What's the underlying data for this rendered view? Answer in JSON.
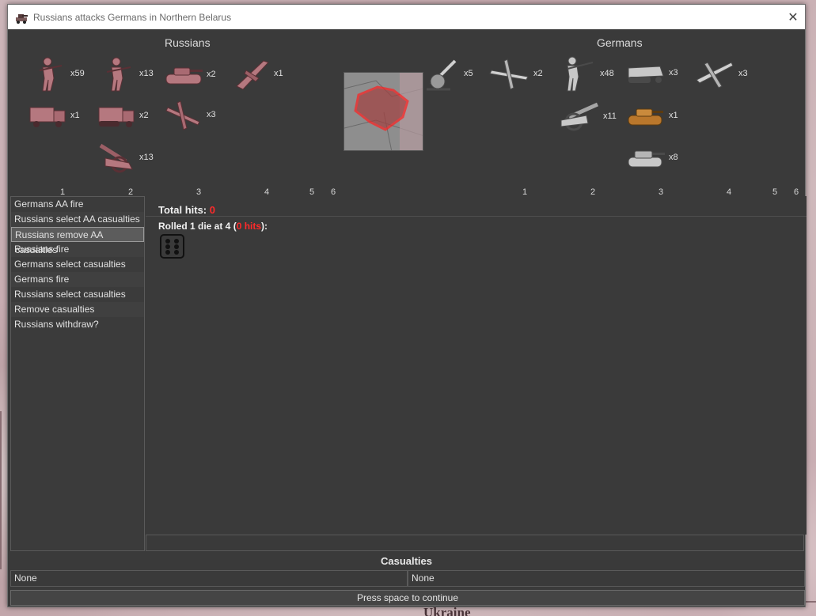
{
  "window": {
    "title": "Russians attacks Germans in Northern Belarus",
    "close_glyph": "✕"
  },
  "battle": {
    "attacker": {
      "name": "Russians",
      "color": "#b5787f",
      "units": [
        {
          "icon": "infantry-icon",
          "count": "x59"
        },
        {
          "icon": "infantry-icon",
          "count": "x13"
        },
        {
          "icon": "tank-icon",
          "count": "x2"
        },
        {
          "icon": "bomber-icon",
          "count": "x1"
        },
        {
          "icon": "truck-icon",
          "count": "x1"
        },
        {
          "icon": "halftrack-icon",
          "count": "x2"
        },
        {
          "icon": "fighter-icon",
          "count": "x3"
        },
        {
          "icon": "artillery-icon",
          "count": "x13"
        }
      ],
      "ruler": [
        "1",
        "2",
        "3",
        "4",
        "5",
        "6"
      ]
    },
    "defender": {
      "name": "Germans",
      "color": "#c8c8c8",
      "units": [
        {
          "icon": "aa-gun-icon",
          "count": "x5"
        },
        {
          "icon": "bomber-icon",
          "count": "x2"
        },
        {
          "icon": "infantry-icon",
          "count": "x48"
        },
        {
          "icon": "halftrack-icon",
          "count": "x3"
        },
        {
          "icon": "fighter-icon",
          "count": "x3"
        },
        {
          "icon": "artillery-icon",
          "count": "x11"
        },
        {
          "icon": "tank-icon",
          "count": "x1"
        },
        {
          "icon": "heavy-tank-icon",
          "count": "x8"
        }
      ],
      "ruler": [
        "1",
        "2",
        "3",
        "4",
        "5",
        "6"
      ]
    }
  },
  "steps": [
    {
      "label": "Germans AA fire"
    },
    {
      "label": "Russians select AA casualties"
    },
    {
      "label": "Russians remove AA casualties"
    },
    {
      "label": "Russians fire"
    },
    {
      "label": "Germans select casualties"
    },
    {
      "label": "Germans fire"
    },
    {
      "label": "Russians select casualties"
    },
    {
      "label": "Remove casualties"
    },
    {
      "label": "Russians withdraw?"
    }
  ],
  "results": {
    "total_hits_label": "Total hits:",
    "total_hits_value": "0",
    "rolled_prefix": "Rolled 1 die at 4 (",
    "rolled_hits": "0 hits",
    "rolled_suffix": "):",
    "die_value": 6
  },
  "casualties": {
    "title": "Casualties",
    "attacker": "None",
    "defender": "None"
  },
  "continue_label": "Press space to continue",
  "colors": {
    "hits": "#ff2a2a",
    "window_bg": "#3a3a3a"
  }
}
